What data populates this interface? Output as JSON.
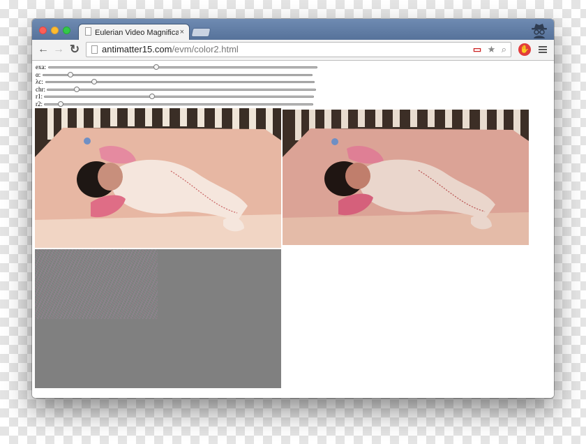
{
  "browser": {
    "tab": {
      "title": "Eulerian Video Magnification",
      "close_glyph": "×"
    },
    "url": {
      "host": "antimatter15.com",
      "path": "/evm/color2.html"
    },
    "buttons": {
      "back": "←",
      "forward": "→",
      "reload": "↻"
    },
    "omnibox_icons": [
      "video-blocked-icon",
      "star-icon",
      "search-icon"
    ],
    "omnibox_glyphs": {
      "video_blocked": "▭",
      "star": "★",
      "zoom": "⌕"
    },
    "extension_glyph": "✋",
    "traffic_lights": {
      "close": "#fc5f57",
      "minimize": "#fdbc2e",
      "maximize": "#34c84a"
    },
    "titlebar_color": "#5f7ba4"
  },
  "controls": {
    "sliders": [
      {
        "label": "exa:",
        "value": 0.4
      },
      {
        "label": "α:",
        "value": 0.1
      },
      {
        "label": "λc:",
        "value": 0.18
      },
      {
        "label": "chr:",
        "value": 0.11
      },
      {
        "label": "r1:",
        "value": 0.4
      },
      {
        "label": "r2:",
        "value": 0.06
      }
    ]
  },
  "panels": {
    "source": {
      "name": "source-video"
    },
    "magnified": {
      "name": "magnified-video"
    },
    "difference": {
      "name": "difference-noise-canvas",
      "background": "#808080"
    }
  }
}
